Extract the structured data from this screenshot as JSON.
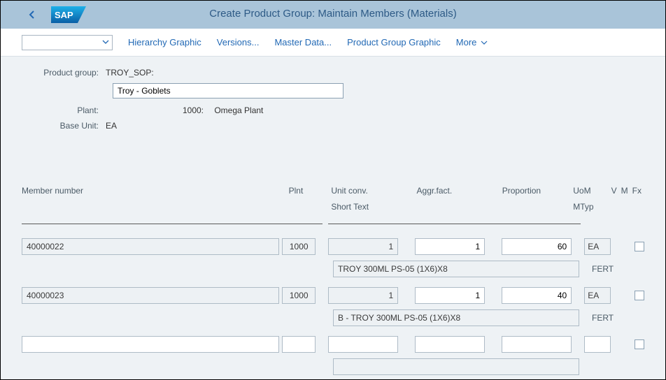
{
  "header": {
    "title": "Create Product Group: Maintain Members (Materials)"
  },
  "toolbar": {
    "hierarchy": "Hierarchy Graphic",
    "versions": "Versions...",
    "master": "Master Data...",
    "prodgroup": "Product Group Graphic",
    "more": "More"
  },
  "form": {
    "product_group_label": "Product group:",
    "product_group_value": "TROY_SOP:",
    "description": "Troy - Goblets",
    "plant_label": "Plant:",
    "plant_code": "1000:",
    "plant_name": "Omega Plant",
    "base_unit_label": "Base Unit:",
    "base_unit_value": "EA"
  },
  "table": {
    "head": {
      "member": "Member number",
      "plnt": "Plnt",
      "unit": "Unit conv.",
      "short": "Short Text",
      "aggr": "Aggr.fact.",
      "prop": "Proportion",
      "uom": "UoM",
      "mtyp": "MTyp",
      "v": "V",
      "m": "M",
      "fx": "Fx"
    },
    "rows": [
      {
        "member": "40000022",
        "plnt": "1000",
        "unit": "1",
        "aggr": "1",
        "prop": "60",
        "uom": "EA",
        "short": "TROY 300ML PS-05 (1X6)X8",
        "mtyp": "FERT"
      },
      {
        "member": "40000023",
        "plnt": "1000",
        "unit": "1",
        "aggr": "1",
        "prop": "40",
        "uom": "EA",
        "short": "B - TROY 300ML PS-05 (1X6)X8",
        "mtyp": "FERT"
      },
      {
        "member": "",
        "plnt": "",
        "unit": "",
        "aggr": "",
        "prop": "",
        "uom": "",
        "short": "",
        "mtyp": ""
      }
    ]
  }
}
